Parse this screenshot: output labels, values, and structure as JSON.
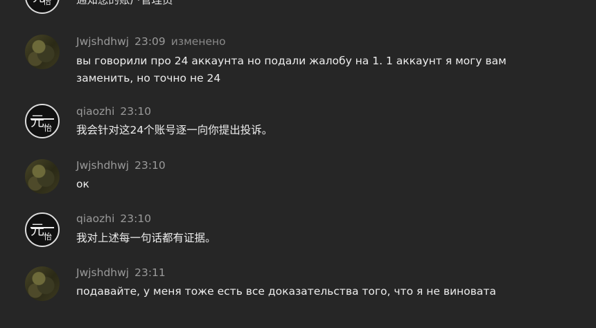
{
  "messages": [
    {
      "author": "",
      "time": "",
      "edited": "",
      "text": "通知您的账户管理员",
      "avatar": "logo"
    },
    {
      "author": "Jwjshdhwj",
      "time": "23:09",
      "edited": "изменено",
      "text": "вы говорили про 24 аккаунта но подали жалобу на 1. 1 аккаунт я могу вам заменить, но точно не 24",
      "avatar": "photo"
    },
    {
      "author": "qiaozhi",
      "time": "23:10",
      "edited": "",
      "text": "我会针对这24个账号逐一向你提出投诉。",
      "avatar": "logo"
    },
    {
      "author": "Jwjshdhwj",
      "time": "23:10",
      "edited": "",
      "text": "ок",
      "avatar": "photo"
    },
    {
      "author": "qiaozhi",
      "time": "23:10",
      "edited": "",
      "text": "我对上述每一句话都有证据。",
      "avatar": "logo"
    },
    {
      "author": "Jwjshdhwj",
      "time": "23:11",
      "edited": "",
      "text": "подавайте, у меня тоже есть все доказательства того, что я не виновата",
      "avatar": "photo"
    }
  ]
}
